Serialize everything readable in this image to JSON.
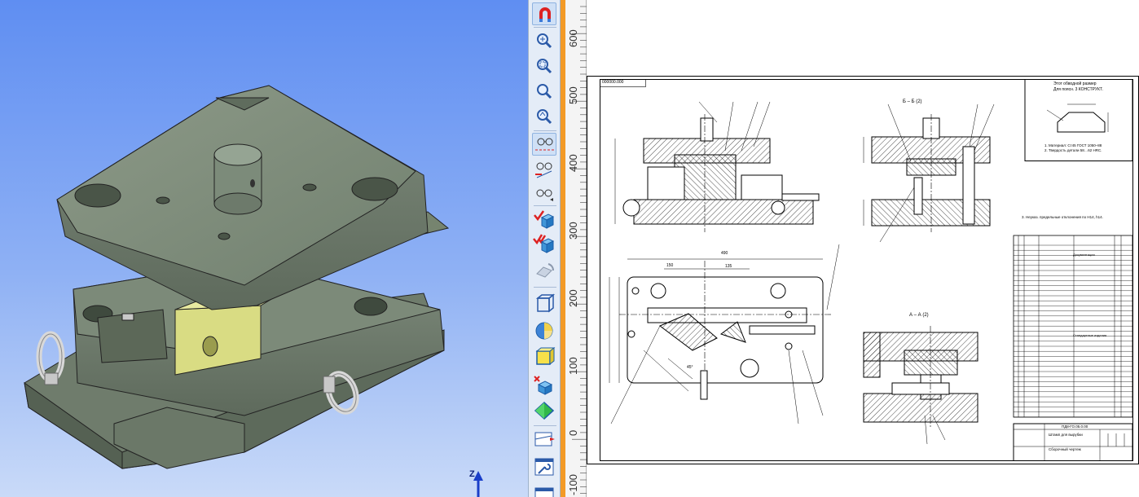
{
  "viewport": {
    "axis_label": "Z",
    "background_top": "#5f8ef2",
    "background_bottom": "#c9daf8"
  },
  "toolbar": {
    "buttons": [
      {
        "name": "magnet-icon",
        "active": true
      },
      {
        "name": "zoom-in-icon",
        "active": false
      },
      {
        "name": "zoom-window-icon",
        "active": false
      },
      {
        "name": "zoom-icon",
        "active": false
      },
      {
        "name": "zoom-previous-icon",
        "active": false
      },
      {
        "name": "show-hidden-lines-icon",
        "active": true
      },
      {
        "name": "hide-lines-icon",
        "active": false
      },
      {
        "name": "edit-lines-icon",
        "active": false
      },
      {
        "name": "view-glasses-icon",
        "active": false
      },
      {
        "name": "check-box-icon",
        "active": false
      },
      {
        "name": "double-check-box-icon",
        "active": false
      },
      {
        "name": "rotate-icon",
        "active": false
      },
      {
        "name": "wireframe-icon",
        "active": false
      },
      {
        "name": "sphere-section-icon",
        "active": false
      },
      {
        "name": "shaded-box-icon",
        "active": false
      },
      {
        "name": "cut-box-icon",
        "active": false
      },
      {
        "name": "shaded-edges-icon",
        "active": false
      },
      {
        "name": "perspective-icon",
        "active": false
      },
      {
        "name": "wrench-view-icon",
        "active": false
      },
      {
        "name": "settings-icon",
        "active": false
      }
    ]
  },
  "ruler": {
    "ticks": [
      "600",
      "500",
      "400",
      "300",
      "200",
      "100",
      "0",
      "-100"
    ]
  },
  "drawing": {
    "stamp": "000000.000",
    "section_bb": "Б – Б (2)",
    "section_aa": "А – А (2)",
    "note_top_right_1": "Этот обводной размер",
    "note_top_right_2": "Для поясн. 3 КОНСТРУКТ.",
    "notes_1": "1. Материал: Ст45 ГОСТ 1050–88",
    "notes_2": "2. Твердость детали 58…62 HRC.",
    "notes_3": "3. Неуказ. предельные отклонения по H14, h14.",
    "table_title_docs": "Документация",
    "table_title_std": "Стандартные изделия",
    "title_block_code": "ПД8-ГО.05.0.00",
    "title_block_name": "Штамп для вырубки",
    "title_block_sub": "Сборочный чертеж",
    "dim_490": "490",
    "dim_150": "150",
    "dim_135": "135",
    "dim_45": "45°"
  }
}
